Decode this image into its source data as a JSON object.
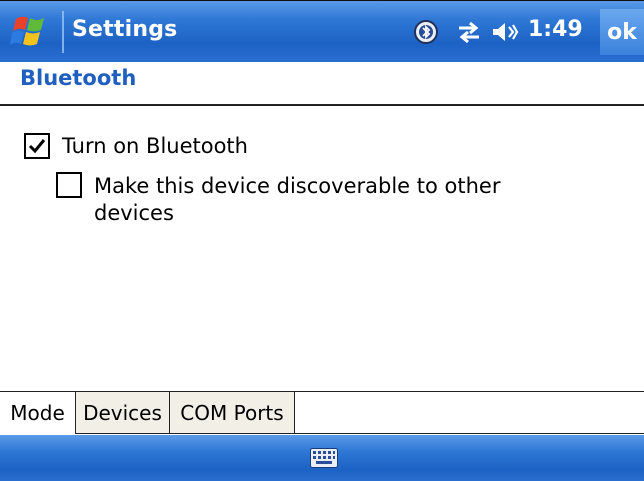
{
  "titlebar": {
    "title": "Settings",
    "clock": "1:49",
    "ok_label": "ok",
    "icons": [
      "windows-start-icon",
      "bluetooth-status-icon",
      "connectivity-icon",
      "volume-icon"
    ]
  },
  "page": {
    "title": "Bluetooth"
  },
  "options": [
    {
      "label": "Turn on Bluetooth",
      "checked": true
    },
    {
      "label_line1": "Make this device discoverable to other",
      "label_line2": "devices",
      "checked": false
    }
  ],
  "tabs": [
    {
      "label": "Mode",
      "active": true
    },
    {
      "label": "Devices",
      "active": false
    },
    {
      "label": "COM Ports",
      "active": false
    }
  ],
  "colors": {
    "title_blue": "#1f5fbf",
    "bar_blue": "#2f78d6"
  }
}
